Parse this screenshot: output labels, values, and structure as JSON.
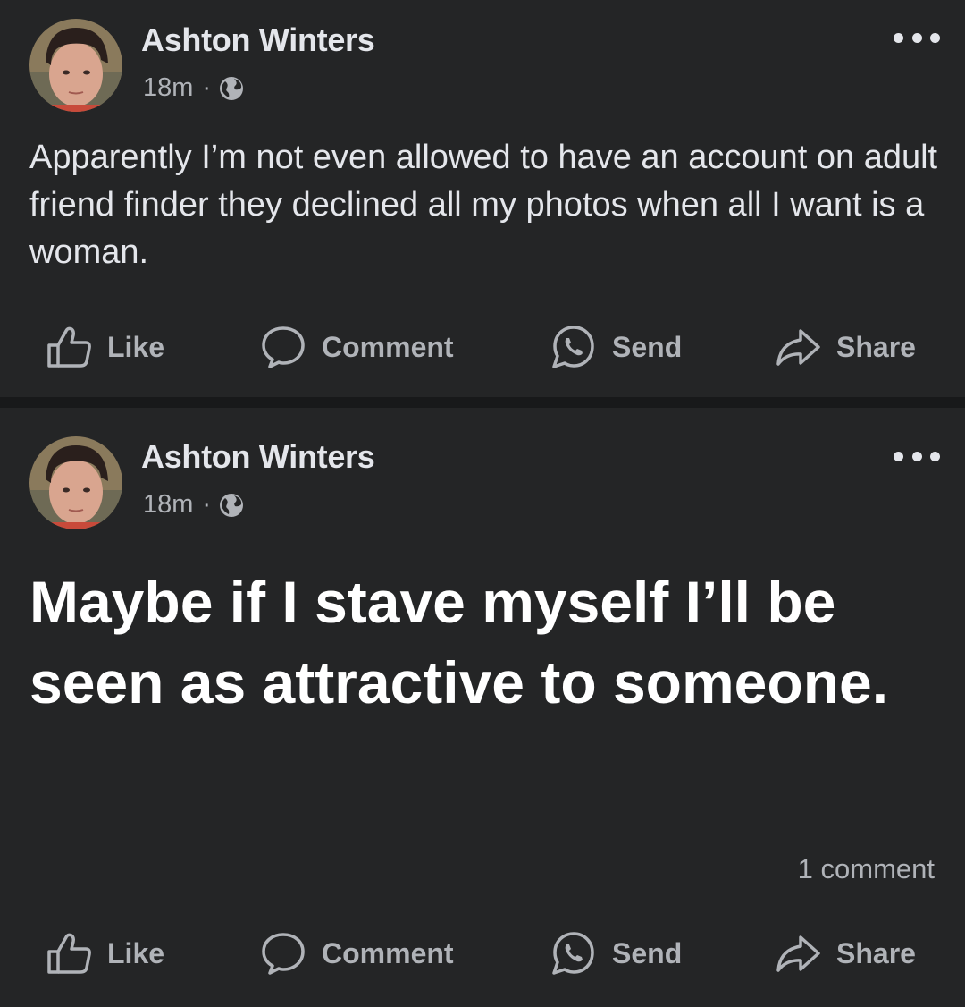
{
  "posts": [
    {
      "author": "Ashton Winters",
      "time": "18m",
      "separator": "·",
      "privacy_icon": "globe-icon",
      "text": "Apparently I’m not even allowed to have an account on adult friend finder they declined all my photos when all I want is a woman.",
      "actions": {
        "like": "Like",
        "comment": "Comment",
        "send": "Send",
        "share": "Share"
      }
    },
    {
      "author": "Ashton Winters",
      "time": "18m",
      "separator": "·",
      "privacy_icon": "globe-icon",
      "text": "Maybe if I stave myself I’ll be seen as attractive to someone.",
      "comment_count": "1 comment",
      "actions": {
        "like": "Like",
        "comment": "Comment",
        "send": "Send",
        "share": "Share"
      }
    }
  ],
  "colors": {
    "background": "#18191a",
    "card": "#242526",
    "primary_text": "#e4e6eb",
    "secondary_text": "#b0b3b8"
  }
}
